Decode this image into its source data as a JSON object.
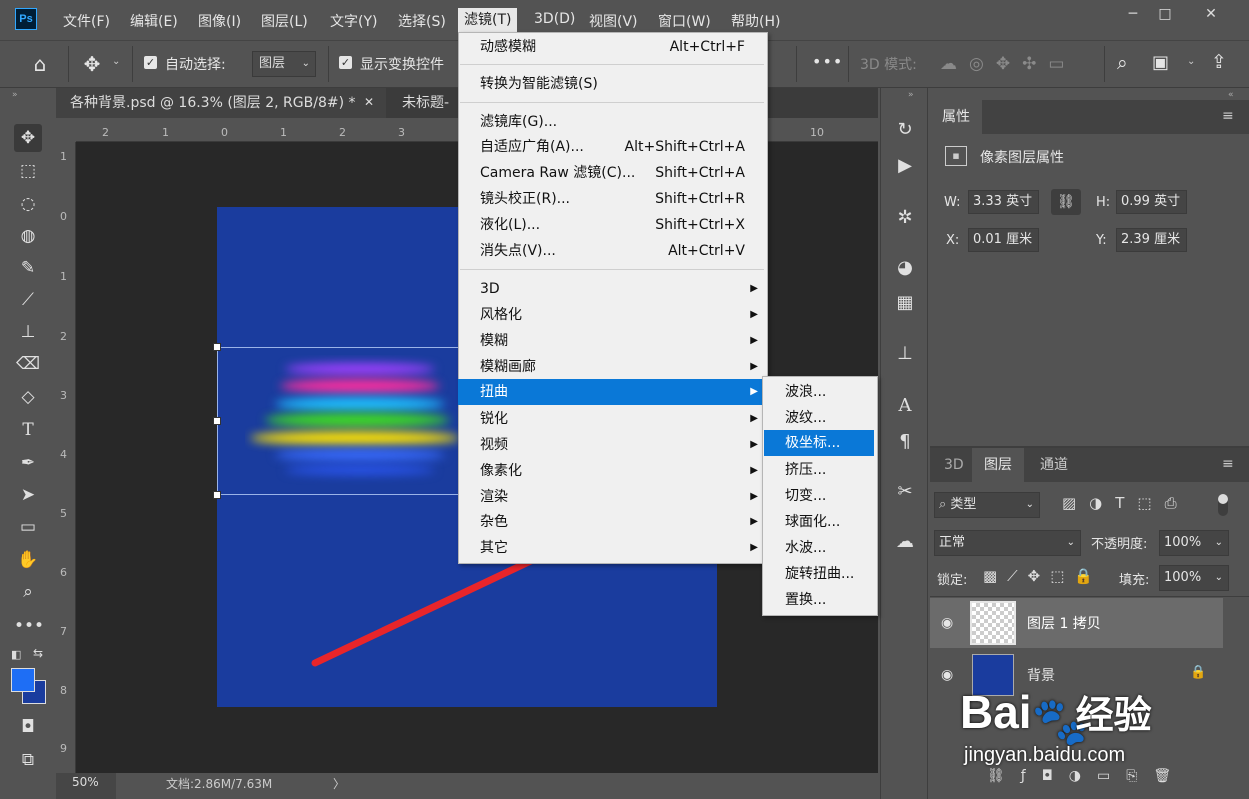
{
  "app": {
    "logo": "Ps"
  },
  "menubar": [
    "文件(F)",
    "编辑(E)",
    "图像(I)",
    "图层(L)",
    "文字(Y)",
    "选择(S)",
    "滤镜(T)",
    "3D(D)",
    "视图(V)",
    "窗口(W)",
    "帮助(H)"
  ],
  "window": {
    "minimize": "─",
    "maximize": "□",
    "close": "✕"
  },
  "options": {
    "auto_select_label": "自动选择:",
    "auto_select_value": "图层",
    "show_transform_label": "显示变换控件",
    "mode_3d_label": "3D 模式:",
    "more": "•••"
  },
  "tabs": [
    {
      "label": "各种背景.psd @ 16.3% (图层 2, RGB/8#) *",
      "close": "✕"
    },
    {
      "label": "未标题-"
    }
  ],
  "rulers": {
    "h": [
      "2",
      "1",
      "0",
      "1",
      "2",
      "3",
      "10"
    ],
    "v": [
      "1",
      "0",
      "1",
      "2",
      "3",
      "4",
      "5",
      "6",
      "7",
      "8",
      "9"
    ]
  },
  "status": {
    "zoom": "50%",
    "doc": "文档:2.86M/7.63M",
    "arrow": "〉"
  },
  "filter_menu": {
    "groups": [
      [
        {
          "label": "动感模糊",
          "shortcut": "Alt+Ctrl+F"
        }
      ],
      [
        {
          "label": "转换为智能滤镜(S)",
          "shortcut": ""
        }
      ],
      [
        {
          "label": "滤镜库(G)...",
          "shortcut": ""
        },
        {
          "label": "自适应广角(A)...",
          "shortcut": "Alt+Shift+Ctrl+A"
        },
        {
          "label": "Camera Raw 滤镜(C)...",
          "shortcut": "Shift+Ctrl+A"
        },
        {
          "label": "镜头校正(R)...",
          "shortcut": "Shift+Ctrl+R"
        },
        {
          "label": "液化(L)...",
          "shortcut": "Shift+Ctrl+X"
        },
        {
          "label": "消失点(V)...",
          "shortcut": "Alt+Ctrl+V"
        }
      ],
      [
        {
          "label": "3D"
        },
        {
          "label": "风格化"
        },
        {
          "label": "模糊"
        },
        {
          "label": "模糊画廊"
        },
        {
          "label": "扭曲"
        },
        {
          "label": "锐化"
        },
        {
          "label": "视频"
        },
        {
          "label": "像素化"
        },
        {
          "label": "渲染"
        },
        {
          "label": "杂色"
        },
        {
          "label": "其它"
        }
      ]
    ],
    "highlighted": "扭曲"
  },
  "distort_submenu": {
    "items": [
      "波浪...",
      "波纹...",
      "极坐标...",
      "挤压...",
      "切变...",
      "球面化...",
      "水波...",
      "旋转扭曲...",
      "置换..."
    ],
    "highlighted": "极坐标..."
  },
  "properties": {
    "tab": "属性",
    "title": "像素图层属性",
    "w_label": "W:",
    "w_value": "3.33 英寸",
    "h_label": "H:",
    "h_value": "0.99 英寸",
    "x_label": "X:",
    "x_value": "0.01 厘米",
    "y_label": "Y:",
    "y_value": "2.39 厘米"
  },
  "layers_panel": {
    "tabs": [
      "3D",
      "图层",
      "通道"
    ],
    "active_tab": "图层",
    "filter_kind": "类型",
    "blend_mode": "正常",
    "opacity_label": "不透明度:",
    "opacity_value": "100%",
    "lock_label": "锁定:",
    "fill_label": "填充:",
    "fill_value": "100%",
    "layers": [
      {
        "name": "图层 1 拷贝",
        "selected": true
      },
      {
        "name": "背景",
        "locked": true
      }
    ]
  },
  "watermark": {
    "brand": "Bai",
    "brand2": "经验",
    "url": "jingyan.baidu.com"
  },
  "colors": {
    "accent": "#0a78d7",
    "doc_blue": "#1a3c9e",
    "arrow_red": "#e8252a",
    "fg_color": "#1e6ef5"
  }
}
